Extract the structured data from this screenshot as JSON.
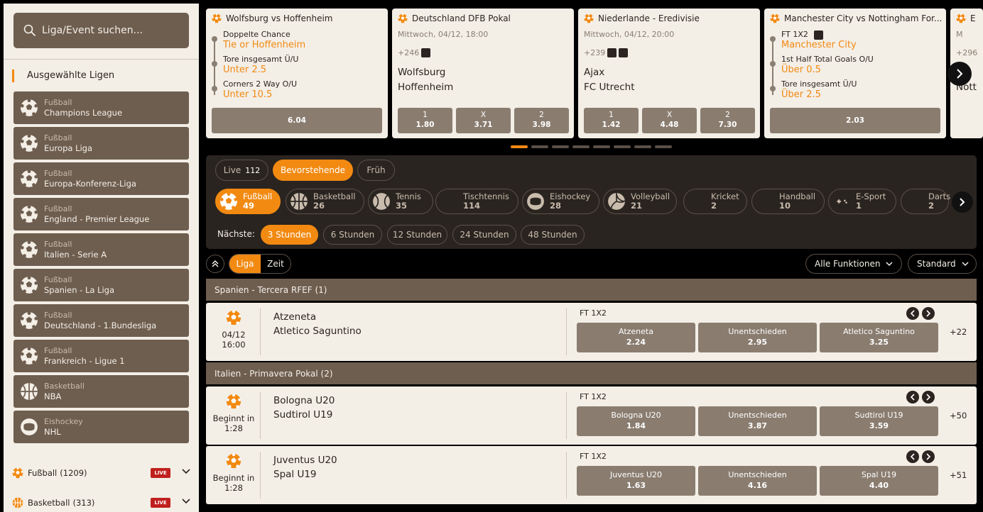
{
  "sidebar": {
    "search_placeholder": "Liga/Event suchen...",
    "selected_title": "Ausgewählte Ligen",
    "leagues": [
      {
        "sport": "Fußball",
        "name": "Champions League",
        "icon": "soccer-ball-icon"
      },
      {
        "sport": "Fußball",
        "name": "Europa Liga",
        "icon": "soccer-ball-icon"
      },
      {
        "sport": "Fußball",
        "name": "Europa-Konferenz-Liga",
        "icon": "soccer-ball-icon"
      },
      {
        "sport": "Fußball",
        "name": "England - Premier League",
        "icon": "soccer-ball-icon"
      },
      {
        "sport": "Fußball",
        "name": "Italien - Serie A",
        "icon": "soccer-ball-icon"
      },
      {
        "sport": "Fußball",
        "name": "Spanien - La Liga",
        "icon": "soccer-ball-icon"
      },
      {
        "sport": "Fußball",
        "name": "Deutschland - 1.Bundesliga",
        "icon": "soccer-ball-icon"
      },
      {
        "sport": "Fußball",
        "name": "Frankreich - Ligue 1",
        "icon": "soccer-ball-icon"
      },
      {
        "sport": "Basketball",
        "name": "NBA",
        "icon": "basketball-icon"
      },
      {
        "sport": "Eishockey",
        "name": "NHL",
        "icon": "hockey-puck-icon"
      }
    ],
    "sports": [
      {
        "label": "Fußball",
        "count": "(1209)",
        "badge": "LIVE"
      },
      {
        "label": "Basketball",
        "count": "(313)",
        "badge": "LIVE"
      }
    ]
  },
  "cards": [
    {
      "header": "Wolfsburg vs Hoffenheim",
      "legs": [
        {
          "market": "Doppelte Chance",
          "pick": "Tie or Hoffenheim"
        },
        {
          "market": "Tore insgesamt Ü/U",
          "pick": "Unter 2.5"
        },
        {
          "market": "Corners 2 Way O/U",
          "pick": "Unter 10.5"
        }
      ],
      "odd": "6.04"
    },
    {
      "header": "Deutschland DFB Pokal",
      "date": "Mittwoch, 04/12, 18:00",
      "more": "+246",
      "home": "Wolfsburg",
      "away": "Hoffenheim",
      "odds": [
        {
          "label": "1",
          "value": "1.80"
        },
        {
          "label": "X",
          "value": "3.71"
        },
        {
          "label": "2",
          "value": "3.98"
        }
      ]
    },
    {
      "header": "Niederlande - Eredivisie",
      "date": "Mittwoch, 04/12, 20:00",
      "more": "+239",
      "home": "Ajax",
      "away": "FC Utrecht",
      "odds": [
        {
          "label": "1",
          "value": "1.42"
        },
        {
          "label": "X",
          "value": "4.48"
        },
        {
          "label": "2",
          "value": "7.30"
        }
      ]
    },
    {
      "header": "Manchester City vs Nottingham For...",
      "legs": [
        {
          "market": "FT 1X2",
          "pick": "Manchester City"
        },
        {
          "market": "1st Half Total Goals O/U",
          "pick": "Über 0.5"
        },
        {
          "market": "Tore insgesamt Ü/U",
          "pick": "Über 2.5"
        }
      ],
      "odd": "2.03"
    },
    {
      "header": "E",
      "date": "M",
      "more": "+296",
      "home": "E",
      "away": "Nott"
    }
  ],
  "tabs": [
    {
      "label": "Live",
      "count": "112"
    },
    {
      "label": "Bevorstehende"
    },
    {
      "label": "Früh"
    }
  ],
  "sports_bar": [
    {
      "label": "Fußball",
      "count": "49",
      "icon": "soccer-ball-icon"
    },
    {
      "label": "Basketball",
      "count": "26",
      "icon": "basketball-icon"
    },
    {
      "label": "Tennis",
      "count": "35",
      "icon": "tennis-ball-icon"
    },
    {
      "label": "Tischtennis",
      "count": "114",
      "icon": "table-tennis-icon"
    },
    {
      "label": "Eishockey",
      "count": "28",
      "icon": "hockey-puck-icon"
    },
    {
      "label": "Volleyball",
      "count": "21",
      "icon": "volleyball-icon"
    },
    {
      "label": "Kricket",
      "count": "2",
      "icon": "cricket-icon"
    },
    {
      "label": "Handball",
      "count": "10",
      "icon": "handball-icon"
    },
    {
      "label": "E-Sport",
      "count": "1",
      "icon": "gamepad-icon"
    },
    {
      "label": "Darts",
      "count": "2",
      "icon": "darts-icon"
    }
  ],
  "next": {
    "label": "Nächste:",
    "options": [
      "3 Stunden",
      "6 Stunden",
      "12 Stunden",
      "24 Stunden",
      "48 Stunden"
    ]
  },
  "controls": {
    "seg_a": "Liga",
    "seg_b": "Zeit",
    "features": "Alle Funktionen",
    "sort": "Standard"
  },
  "groups": [
    {
      "title": "Spanien - Tercera RFEF  (1)",
      "events": [
        {
          "date": "04/12",
          "time": "16:00",
          "home": "Atzeneta",
          "away": "Atletico Saguntino",
          "market": "FT 1X2",
          "odds": [
            {
              "label": "Atzeneta",
              "value": "2.24"
            },
            {
              "label": "Unentschieden",
              "value": "2.95"
            },
            {
              "label": "Atletico Saguntino",
              "value": "3.25"
            }
          ],
          "more": "+22"
        }
      ]
    },
    {
      "title": "Italien - Primavera Pokal (2)",
      "events": [
        {
          "date": "Beginnt in",
          "time": "1:28",
          "home": "Bologna U20",
          "away": "Sudtirol U19",
          "market": "FT 1X2",
          "odds": [
            {
              "label": "Bologna U20",
              "value": "1.84"
            },
            {
              "label": "Unentschieden",
              "value": "3.87"
            },
            {
              "label": "Sudtirol U19",
              "value": "3.59"
            }
          ],
          "more": "+50"
        },
        {
          "date": "Beginnt in",
          "time": "1:28",
          "home": "Juventus U20",
          "away": "Spal U19",
          "market": "FT 1X2",
          "odds": [
            {
              "label": "Juventus U20",
              "value": "1.63"
            },
            {
              "label": "Unentschieden",
              "value": "4.16"
            },
            {
              "label": "Spal U19",
              "value": "4.40"
            }
          ],
          "more": "+51"
        }
      ]
    }
  ],
  "colors": {
    "accent": "#f28a12",
    "panel": "#f3eee6",
    "button": "#6e5e50",
    "odds": "#8a7d70",
    "live": "#c0201d"
  }
}
